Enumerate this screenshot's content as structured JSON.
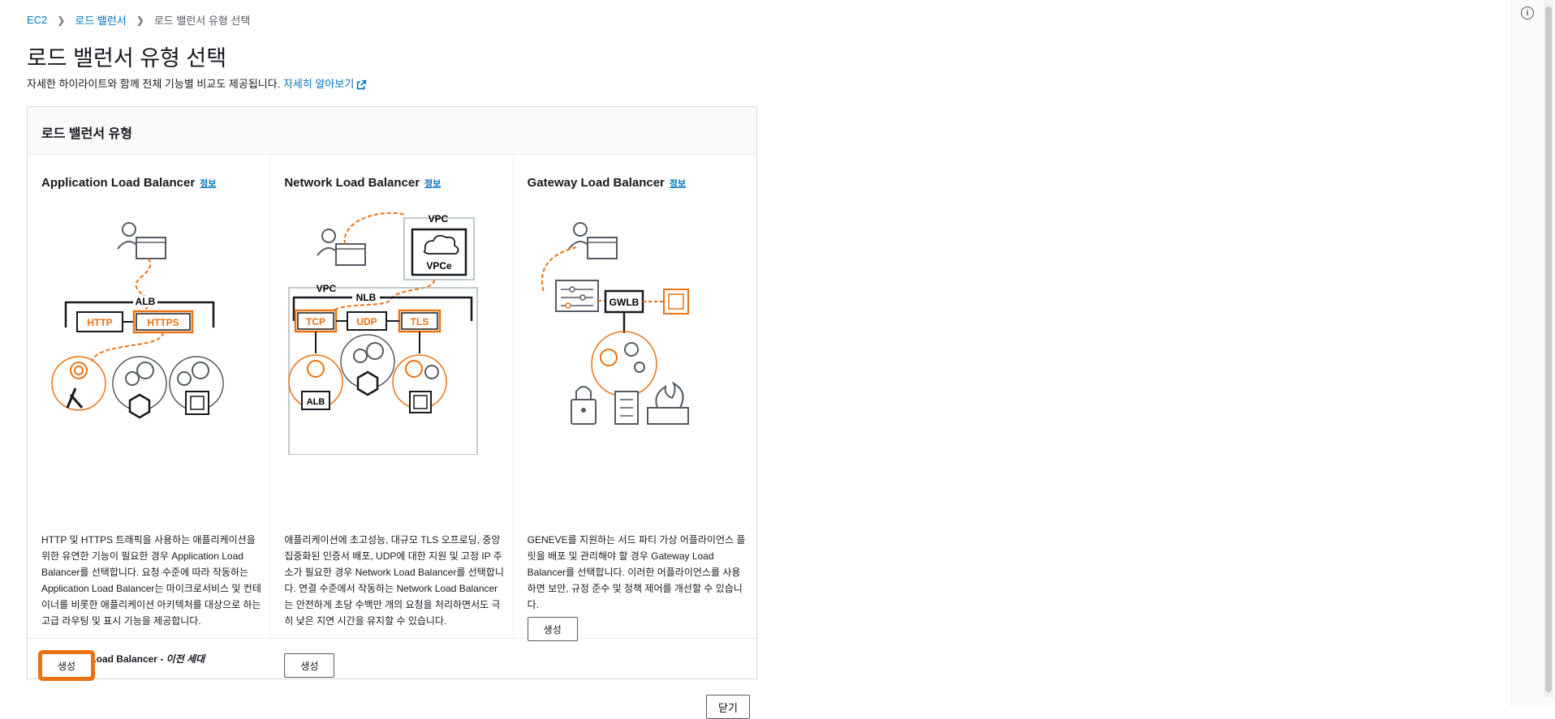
{
  "breadcrumb": {
    "items": [
      "EC2",
      "로드 밸런서"
    ],
    "current": "로드 밸런서 유형 선택"
  },
  "page": {
    "title": "로드 밸런서 유형 선택",
    "subtitle": "자세한 하이라이트와 함께 전체 기능별 비교도 제공됩니다.",
    "learn_more": "자세히 알아보기"
  },
  "panel": {
    "header": "로드 밸런서 유형"
  },
  "cards": [
    {
      "title": "Application Load Balancer",
      "info": "정보",
      "description": "HTTP 및 HTTPS 트래픽을 사용하는 애플리케이션을 위한 유연한 기능이 필요한 경우 Application Load Balancer를 선택합니다. 요청 수준에 따라 작동하는 Application Load Balancer는 마이크로서비스 및 컨테이너를 비롯한 애플리케이션 아키텍처를 대상으로 하는 고급 라우팅 및 표시 기능을 제공합니다.",
      "button": "생성",
      "diagram": {
        "alb": "ALB",
        "http": "HTTP",
        "https": "HTTPS"
      }
    },
    {
      "title": "Network Load Balancer",
      "info": "정보",
      "description": "애플리케이션에 초고성능, 대규모 TLS 오프로딩, 중앙 집중화된 인증서 배포, UDP에 대한 지원 및 고정 IP 주소가 필요한 경우 Network Load Balancer를 선택합니다. 연결 수준에서 작동하는 Network Load Balancer는 안전하게 초당 수백만 개의 요청을 처리하면서도 극히 낮은 지연 시간을 유지할 수 있습니다.",
      "button": "생성",
      "diagram": {
        "vpc_top": "VPC",
        "vpce": "VPCe",
        "vpc": "VPC",
        "nlb": "NLB",
        "tcp": "TCP",
        "udp": "UDP",
        "tls": "TLS",
        "alb": "ALB"
      }
    },
    {
      "title": "Gateway Load Balancer",
      "info": "정보",
      "description": "GENEVE를 지원하는 서드 파티 가상 어플라이언스 플릿을 배포 및 관리해야 할 경우 Gateway Load Balancer를 선택합니다. 이러한 어플라이언스를 사용하면 보안, 규정 준수 및 정책 제어를 개선할 수 있습니다.",
      "button": "생성",
      "diagram": {
        "gwlb": "GWLB"
      }
    }
  ],
  "classic": {
    "label": "Classic Load Balancer",
    "suffix": "이전 세대"
  },
  "footer": {
    "close": "닫기"
  },
  "colors": {
    "accent": "#ec7211",
    "link": "#0073bb",
    "text": "#16191f"
  }
}
